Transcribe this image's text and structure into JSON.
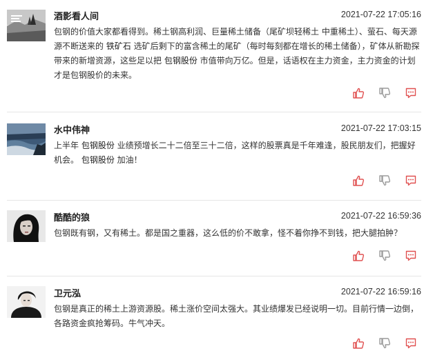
{
  "colors": {
    "accent": "#e05050",
    "muted": "#9a9a9a",
    "divider": "#e6e6e6"
  },
  "icons": {
    "like": "thumb-up-icon",
    "dislike": "thumb-down-icon",
    "comment": "comment-icon"
  },
  "posts": [
    {
      "username": "酒影看人间",
      "time": "2021-07-22 17:05:16",
      "segments": [
        {
          "text": "包钢的价值大家都看得到。稀土钢高利润、巨量稀土储备（尾矿坝轻稀土 中重稀土）、萤石、每天源源不断送来的 "
        },
        {
          "text": "铁矿石",
          "stock": true
        },
        {
          "text": " 选矿后剩下的富含稀土的尾矿（每时每刻都在增长的稀土储备），矿体从新勘探带来的新增资源，这些足以把 "
        },
        {
          "text": "包钢股份",
          "stock": true
        },
        {
          "text": " 市值带向万亿。但是，话语权在主力资金，主力资金的计划才是包钢股价的未来。"
        }
      ]
    },
    {
      "username": "水中伟神",
      "time": "2021-07-22 17:03:15",
      "segments": [
        {
          "text": "上半年 "
        },
        {
          "text": "包钢股份",
          "stock": true
        },
        {
          "text": " 业绩预增长二十二倍至三十二倍，这样的股票真是千年难逢，股民朋友们，把握好机会。 "
        },
        {
          "text": "包钢股份",
          "stock": true
        },
        {
          "text": " 加油！"
        }
      ]
    },
    {
      "username": "酷酷的狼",
      "time": "2021-07-22 16:59:36",
      "segments": [
        {
          "text": "包钢既有钢，又有稀土。都是国之重器，这么低的价不敢拿，怪不着你挣不到钱，把大腿拍肿？"
        }
      ]
    },
    {
      "username": "卫元泓",
      "time": "2021-07-22 16:59:16",
      "segments": [
        {
          "text": "包钢是真正的稀土上游资源股。稀土涨价空间太强大。其业绩爆发已经说明一切。目前行情一边倒，各路资金疯抢筹码。牛气冲天。"
        }
      ]
    }
  ]
}
